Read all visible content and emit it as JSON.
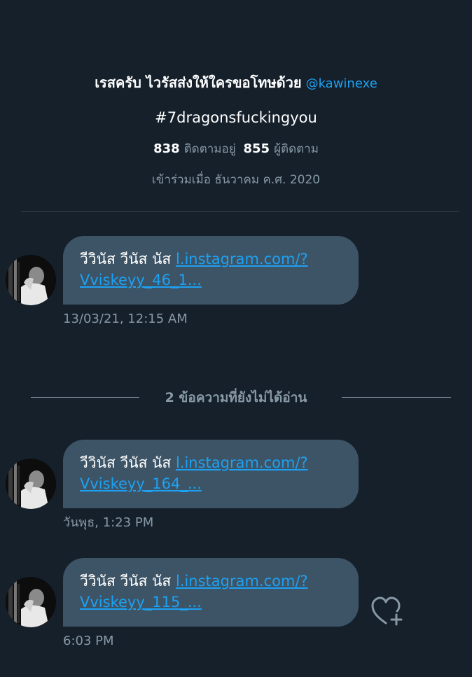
{
  "profile": {
    "name": "เรสครับ ไวรัสส่งให้ใครขอโทษด้วย",
    "handle": "@kawinexe",
    "bio": "#7dragonsfuckingyou",
    "following_count": "838",
    "following_label": "ติดตามอยู่",
    "followers_count": "855",
    "followers_label": "ผู้ติดตาม",
    "joined": "เข้าร่วมเมื่อ ธันวาคม ค.ศ. 2020"
  },
  "unread_divider": {
    "label": "2 ข้อความที่ยังไม่ได้อ่าน"
  },
  "messages": [
    {
      "text": "วีวินัส วีนัส นัส",
      "link_part1": "l.instagram.com/?",
      "link_part2": "Vviskeyy_46_1...",
      "time": "13/03/21, 12:15 AM"
    },
    {
      "text": "วีวินัส วีนัส นัส",
      "link_part1": "l.instagram.com/?",
      "link_part2": "Vviskeyy_164_...",
      "time": "วันพุธ, 1:23 PM"
    },
    {
      "text": "วีวินัส วีนัส นัส",
      "link_part1": "l.instagram.com/?",
      "link_part2": "Vviskeyy_115_...",
      "time": "6:03 PM"
    }
  ],
  "icons": {
    "like": "heart-plus-icon",
    "accent": "#1da1f2",
    "bubble": "#3d5466",
    "background": "#15202b"
  }
}
